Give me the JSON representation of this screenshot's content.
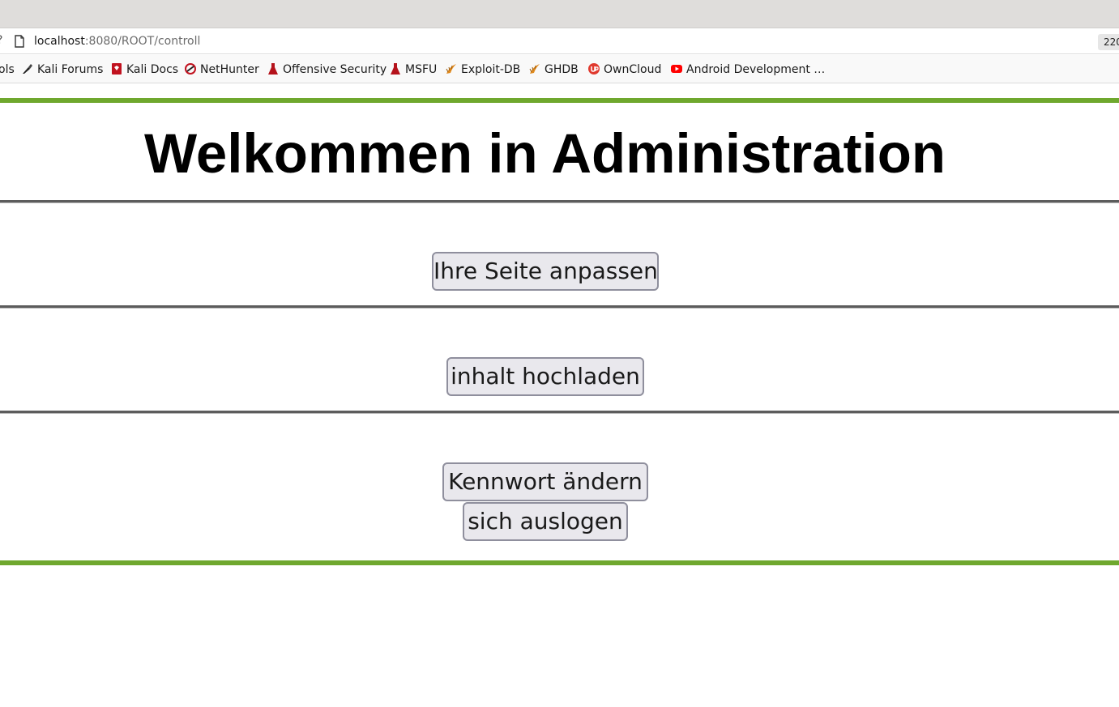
{
  "browser": {
    "url_host": "localhost",
    "url_path": ":8080/ROOT/controll",
    "zoom_label": "220",
    "left_edge_glyph": "?",
    "bookmarks": [
      {
        "label": "ols",
        "icon": "none"
      },
      {
        "label": "Kali Forums",
        "icon": "kali-dragon-icon"
      },
      {
        "label": "Kali Docs",
        "icon": "kali-docs-icon"
      },
      {
        "label": "NetHunter",
        "icon": "nethunter-icon"
      },
      {
        "label": "Offensive Security",
        "icon": "offsec-icon"
      },
      {
        "label": "MSFU",
        "icon": "msfu-icon"
      },
      {
        "label": "Exploit-DB",
        "icon": "exploit-db-icon"
      },
      {
        "label": "GHDB",
        "icon": "ghdb-icon"
      },
      {
        "label": "OwnCloud",
        "icon": "owncloud-icon"
      },
      {
        "label": "Android Development …",
        "icon": "youtube-icon"
      }
    ]
  },
  "page": {
    "title": "Welkommen in Administration",
    "buttons": {
      "customize": "Ihre Seite anpassen",
      "upload": "inhalt hochladen",
      "change_password": "Kennwort ändern",
      "logout": "sich auslogen"
    }
  },
  "colors": {
    "accent_green": "#6fa82e",
    "divider_grey": "#5c5c5c",
    "button_bg": "#e9e8ed",
    "button_border": "#8f8f9d"
  }
}
